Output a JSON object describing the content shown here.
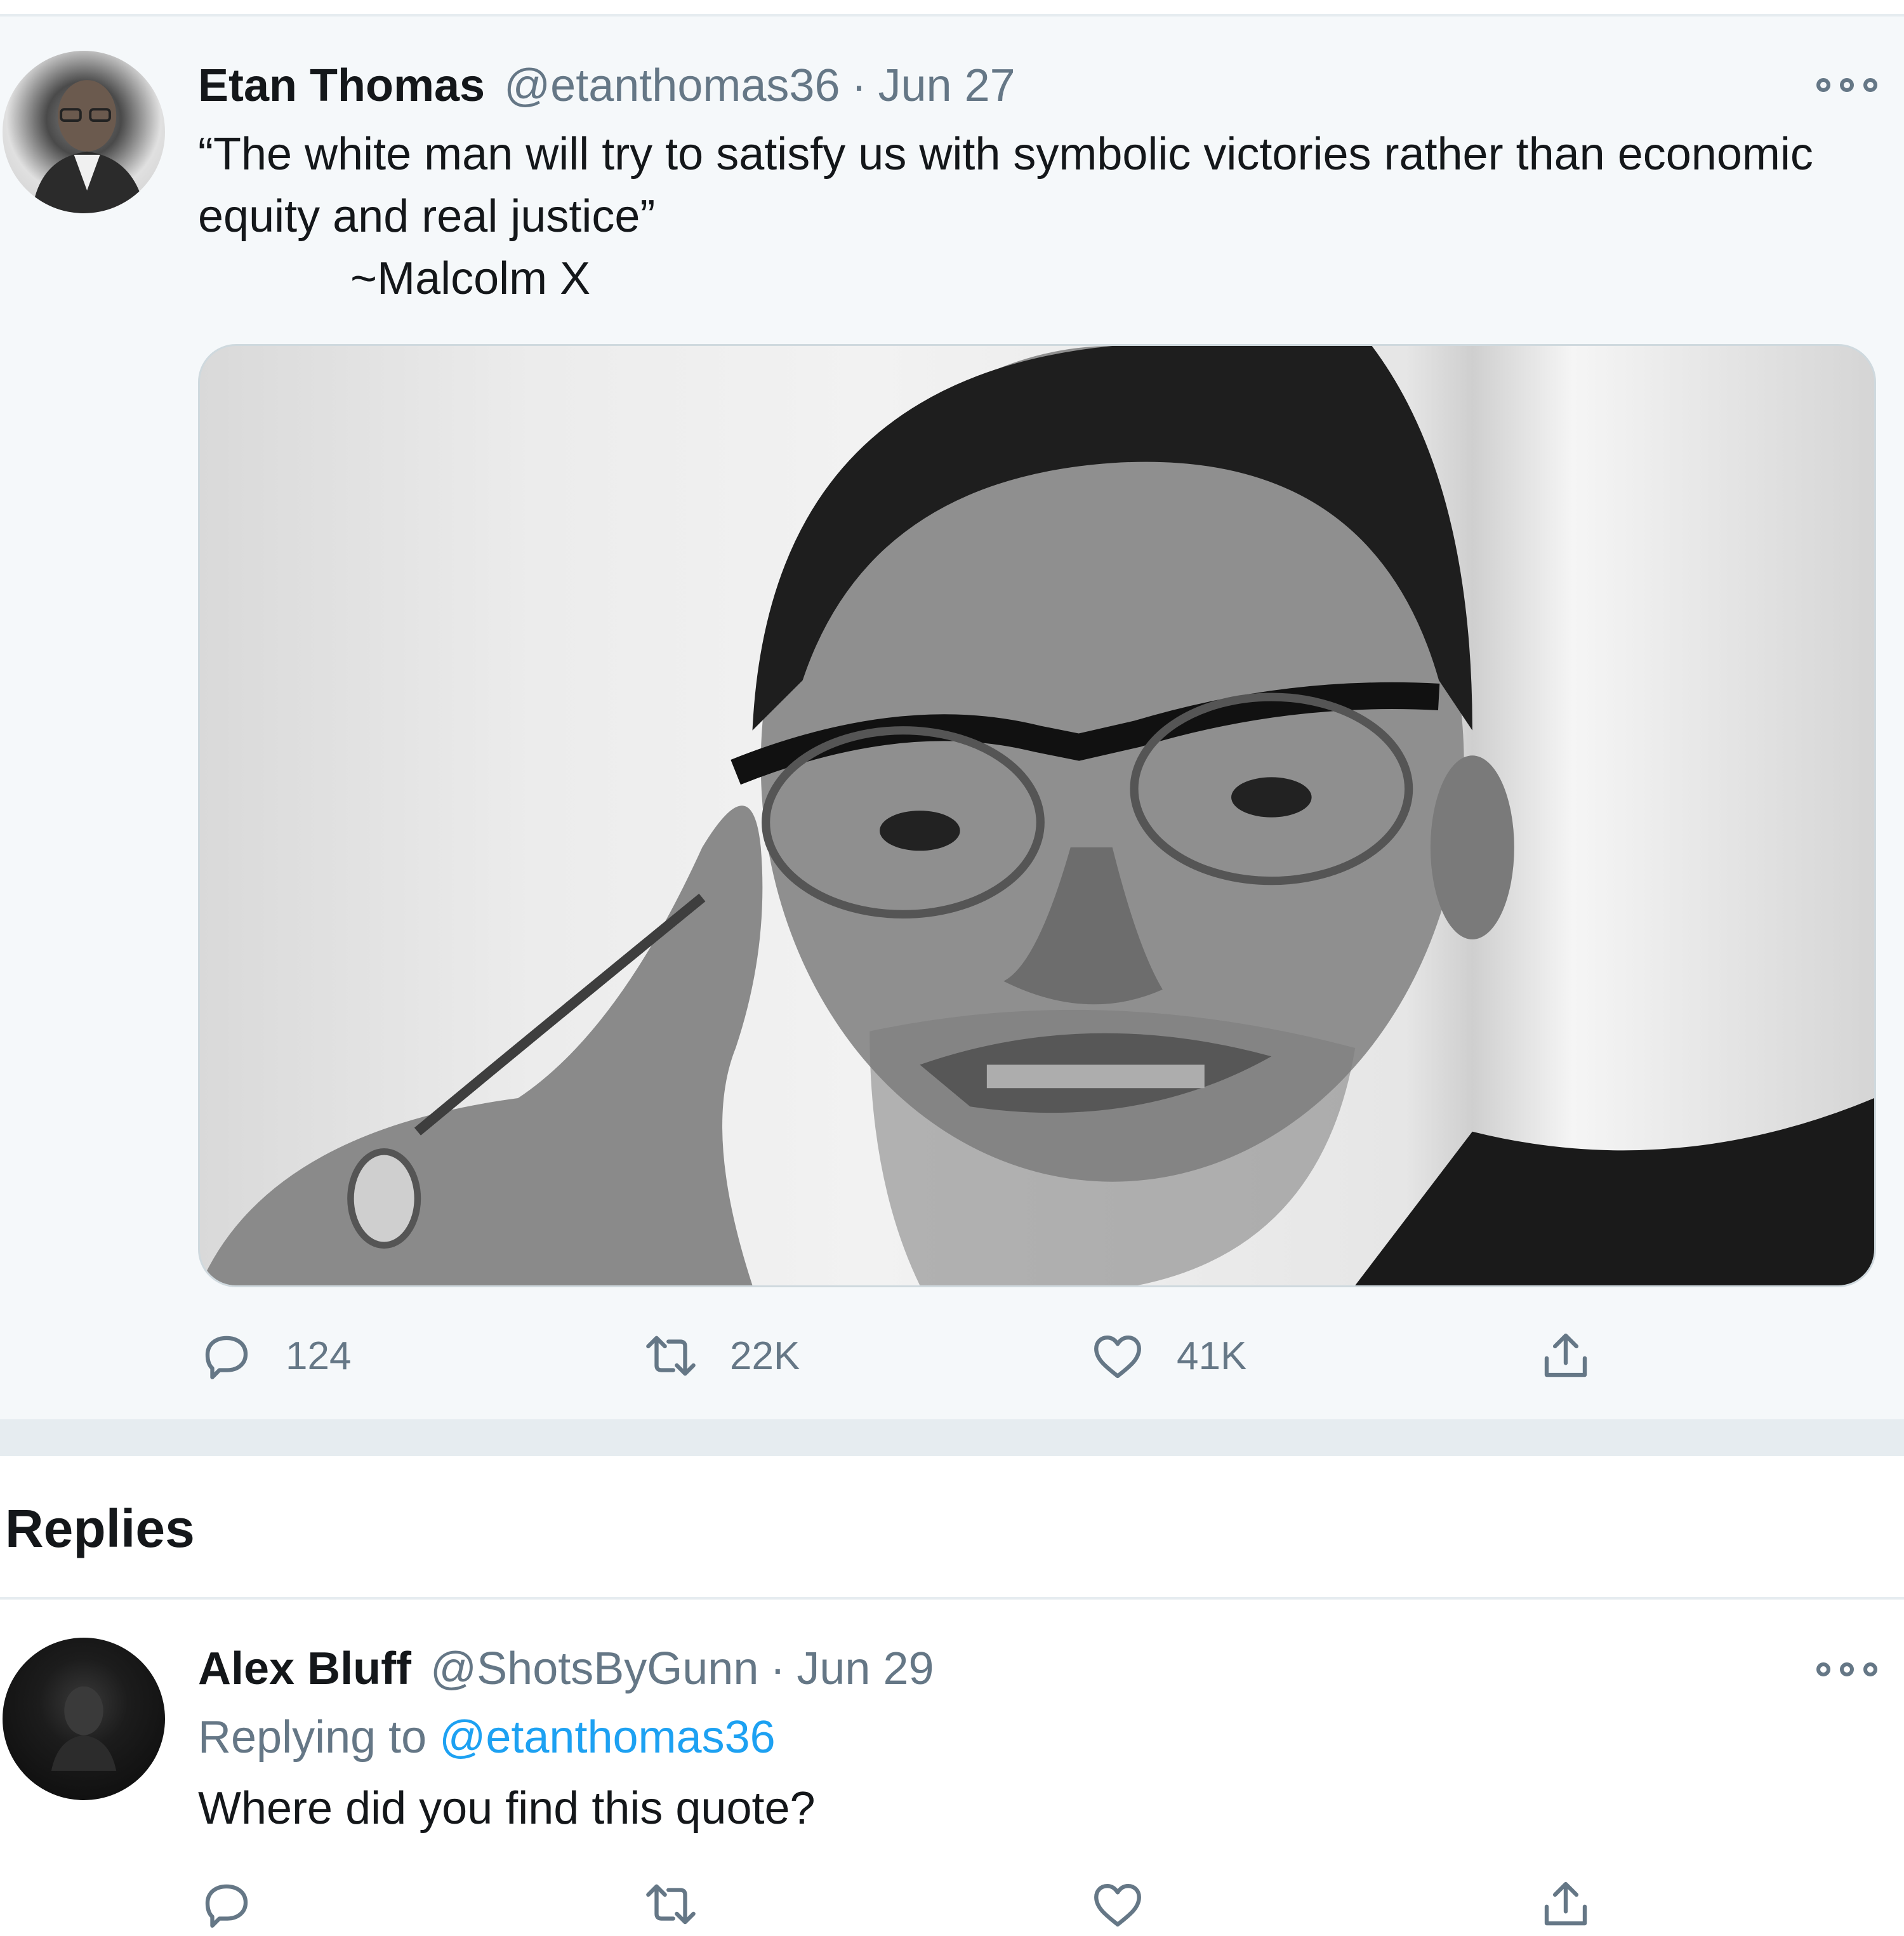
{
  "tweet": {
    "author": {
      "name": "Etan Thomas",
      "handle": "@etanthomas36",
      "avatar_icon": "avatar-photo"
    },
    "separator": "·",
    "date": "Jun 27",
    "text": "“The white man will try to satisfy us with symbolic victories rather than economic equity and real justice”\n            ~Malcolm X",
    "media_icon": "portrait-photo",
    "actions": {
      "reply": {
        "icon": "reply-icon",
        "count": "124"
      },
      "retweet": {
        "icon": "retweet-icon",
        "count": "22K"
      },
      "like": {
        "icon": "heart-icon",
        "count": "41K"
      },
      "share": {
        "icon": "share-icon"
      }
    },
    "more_icon": "more-icon"
  },
  "replies": {
    "title": "Replies",
    "items": [
      {
        "author": {
          "name": "Alex Bluff",
          "handle": "@ShotsByGunn"
        },
        "separator": "·",
        "date": "Jun 29",
        "replying_to_label": "Replying to",
        "replying_to_handle": "@etanthomas36",
        "text": "Where did you find this quote?"
      }
    ]
  },
  "colors": {
    "accent": "#1da1f2",
    "secondary_text": "#657786",
    "primary_text": "#14171a",
    "tweet_bg": "#f5f8fa",
    "divider": "#e6ecf0"
  }
}
